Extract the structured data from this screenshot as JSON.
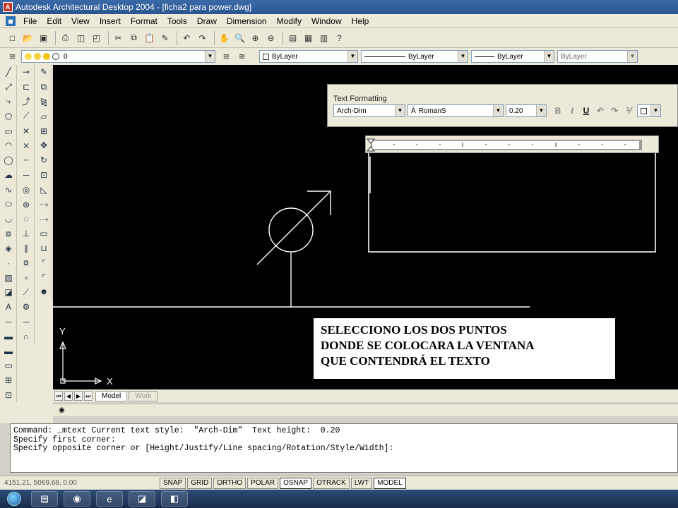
{
  "window": {
    "title": "Autodesk Architectural Desktop 2004 - [ficha2 para power.dwg]"
  },
  "menu": [
    "File",
    "Edit",
    "View",
    "Insert",
    "Format",
    "Tools",
    "Draw",
    "Dimension",
    "Modify",
    "Window",
    "Help"
  ],
  "layer_toolbar": {
    "layer_name": "0",
    "color": "ByLayer",
    "linetype": "ByLayer",
    "lineweight": "ByLayer",
    "plotstyle": "ByLayer"
  },
  "text_formatting": {
    "title": "Text Formatting",
    "style": "Arch-Dim",
    "font": "RomanS",
    "height": "0.20",
    "bold": "B",
    "italic": "I",
    "underline": "U"
  },
  "ucs": {
    "y_label": "Y",
    "x_label": "X"
  },
  "tabs": {
    "model": "Model",
    "work": "Work"
  },
  "annotation": {
    "line1": "SELECCIONO LOS DOS PUNTOS",
    "line2": "DONDE SE COLOCARA LA VENTANA",
    "line3": "QUE CONTENDRÁ  EL TEXTO"
  },
  "command_lines": [
    "Command: _mtext Current text style:  \"Arch-Dim\"  Text height:  0.20",
    "Specify first corner:",
    "Specify opposite corner or [Height/Justify/Line spacing/Rotation/Style/Width]:"
  ],
  "status": {
    "coords": "4151.21, 5069.68, 0.00",
    "buttons": [
      "SNAP",
      "GRID",
      "ORTHO",
      "POLAR",
      "OSNAP",
      "OTRACK",
      "LWT",
      "MODEL"
    ],
    "active": [
      "OSNAP",
      "MODEL"
    ]
  },
  "colors": {
    "canvas": "#000000",
    "titlebar": "#2a5590",
    "ui": "#ece9d8"
  }
}
